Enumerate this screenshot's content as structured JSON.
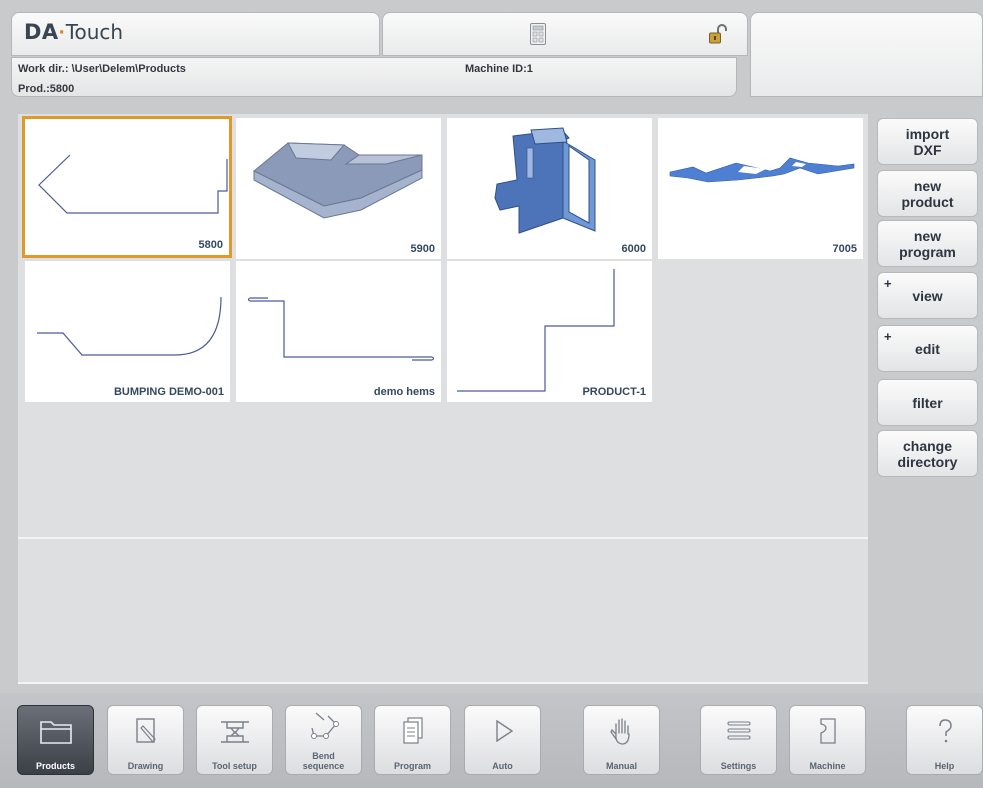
{
  "header": {
    "logo_brand": "DA",
    "logo_dot": "·",
    "logo_product": "Touch",
    "work_dir": "Work dir.: \\User\\Delem\\Products",
    "machine_id": "Machine ID:1",
    "product": "Prod.:5800"
  },
  "products": [
    {
      "label": "5800",
      "selected": true
    },
    {
      "label": "5900",
      "selected": false
    },
    {
      "label": "6000",
      "selected": false
    },
    {
      "label": "7005",
      "selected": false
    },
    {
      "label": "BUMPING DEMO-001",
      "selected": false
    },
    {
      "label": "demo hems",
      "selected": false
    },
    {
      "label": "PRODUCT-1",
      "selected": false
    }
  ],
  "side_buttons": {
    "import_dxf": {
      "line1": "import",
      "line2": "DXF"
    },
    "new_product": {
      "line1": "new",
      "line2": "product"
    },
    "new_program": {
      "line1": "new",
      "line2": "program"
    },
    "view": {
      "label": "view",
      "plus": "+"
    },
    "edit": {
      "label": "edit",
      "plus": "+"
    },
    "filter": {
      "label": "filter"
    },
    "change_directory": {
      "line1": "change",
      "line2": "directory"
    }
  },
  "toolbar": {
    "products": "Products",
    "drawing": "Drawing",
    "tool_setup": "Tool setup",
    "bend_sequence_1": "Bend",
    "bend_sequence_2": "sequence",
    "program": "Program",
    "auto": "Auto",
    "manual": "Manual",
    "settings": "Settings",
    "machine": "Machine",
    "help": "Help"
  },
  "colors": {
    "accent_orange": "#e09a2a",
    "part_blue": "#6f8fd6",
    "line_blue": "#4a5a9a"
  },
  "icons": [
    "calculator-icon",
    "unlock-icon",
    "folder-icon",
    "drawing-icon",
    "tool-setup-icon",
    "bend-sequence-icon",
    "program-icon",
    "play-icon",
    "hand-icon",
    "list-icon",
    "machine-icon",
    "help-icon"
  ]
}
